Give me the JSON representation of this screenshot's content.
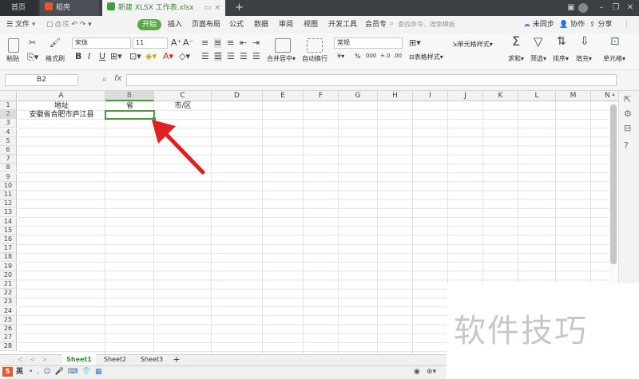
{
  "tabs": {
    "home": "首页",
    "doc": "稻壳",
    "active": "新建 XLSX 工作表.xlsx"
  },
  "menu": {
    "file": "文件",
    "start": "开始",
    "insert": "插入",
    "layout": "页面布局",
    "formula": "公式",
    "data": "数据",
    "review": "审阅",
    "view": "视图",
    "dev": "开发工具",
    "vip": "会员专享",
    "search_placeholder": "查找命令、搜索模板",
    "sync": "未同步",
    "collab": "协作",
    "share": "分享"
  },
  "ribbon": {
    "paste": "粘贴",
    "format_painter": "格式刷",
    "font_name": "宋体",
    "font_size": "11",
    "merge_center": "合并居中",
    "wrap": "自动换行",
    "number_format": "常规",
    "currency": "¥",
    "percent": "%",
    "thousands": "000",
    "inc_dec": "+.0",
    "dec_dec": ".00",
    "table_style": "表格样式",
    "cond_format": "条件格式",
    "cell_style": "单元格样式",
    "sum": "求和",
    "filter": "筛选",
    "sort": "排序",
    "fill": "填充",
    "cells": "单元格"
  },
  "formula_bar": {
    "name_box": "B2",
    "fx": "fx"
  },
  "grid": {
    "columns": [
      "A",
      "B",
      "C",
      "D",
      "E",
      "F",
      "G",
      "H",
      "I",
      "J",
      "K",
      "L",
      "M",
      "N"
    ],
    "rows": [
      "1",
      "2",
      "3",
      "4",
      "5",
      "6",
      "7",
      "8",
      "9",
      "10",
      "11",
      "12",
      "13",
      "14",
      "15",
      "16",
      "17",
      "18",
      "19",
      "20",
      "21",
      "22",
      "23",
      "24",
      "25",
      "26",
      "27",
      "28"
    ],
    "selected_cell": "B2",
    "cells": {
      "A1": "地址",
      "B1": "省",
      "C1": "市/区",
      "A2": "安徽省合肥市庐江县"
    }
  },
  "sheets": [
    "Sheet1",
    "Sheet2",
    "Sheet3"
  ],
  "active_sheet": "Sheet1",
  "status": {
    "ime": "英"
  },
  "watermark": "软件技巧",
  "colors": {
    "accent_green": "#4c9a3e",
    "arrow_red": "#e02020"
  }
}
